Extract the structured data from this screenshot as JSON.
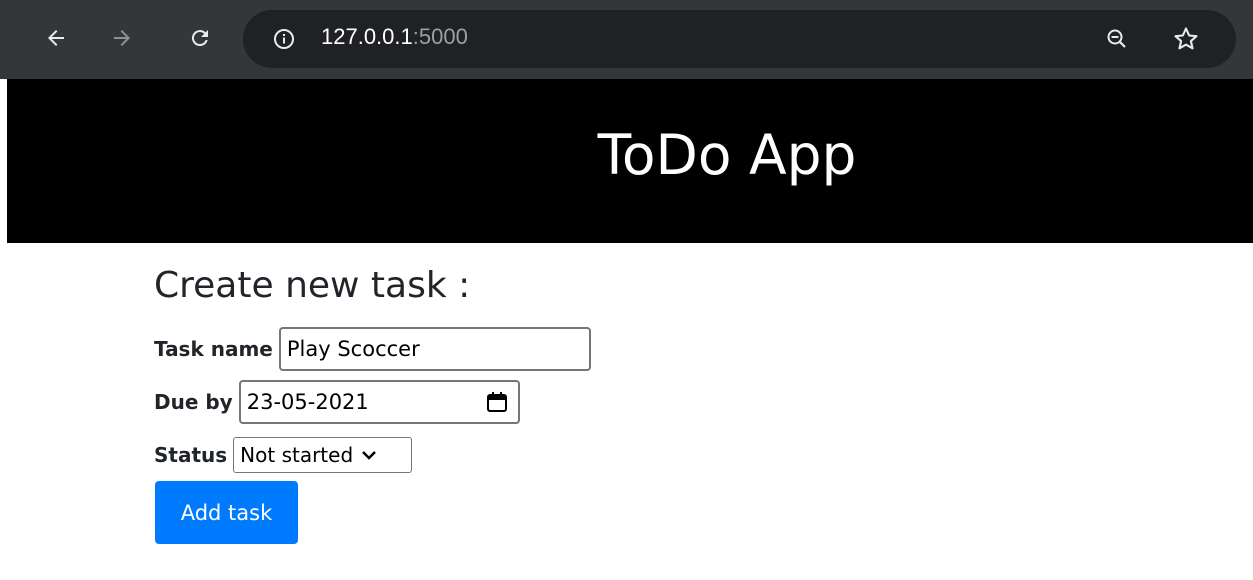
{
  "browser": {
    "url_host": "127.0.0.1",
    "url_port": ":5000",
    "icons": [
      "back-arrow-icon",
      "forward-arrow-icon",
      "reload-icon",
      "info-icon",
      "zoom-out-icon",
      "star-icon"
    ]
  },
  "header": {
    "title": "ToDo App"
  },
  "form": {
    "heading": "Create new task :",
    "task_name_label": "Task name",
    "task_name_value": "Play Scoccer",
    "due_label": "Due by",
    "due_value": "23-05-2021",
    "status_label": "Status",
    "status_value": "Not started",
    "submit_label": "Add task"
  },
  "colors": {
    "browser_bar": "#35363a",
    "omnibox": "#202124",
    "header_bg": "#000000",
    "button_bg": "#007bff"
  }
}
